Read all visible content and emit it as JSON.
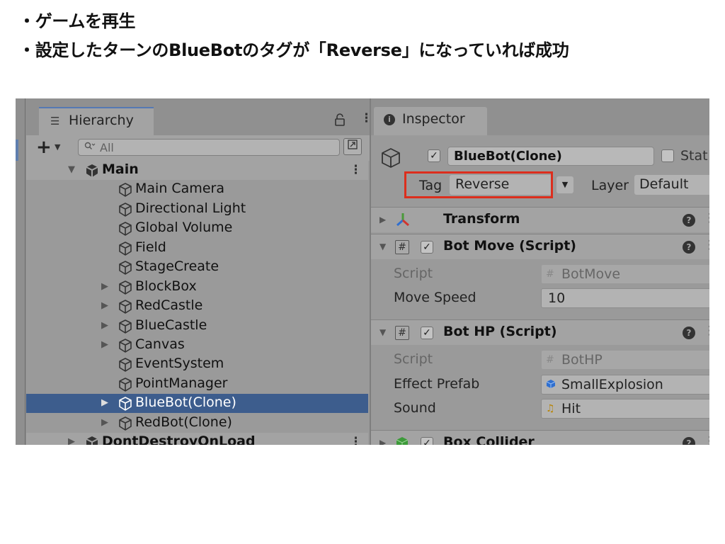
{
  "slide": {
    "bullets": [
      "・ゲームを再生",
      "・設定したターンのBlueBotのタグが「Reverse」になっていれば成功"
    ]
  },
  "hierarchy": {
    "tab_label": "Hierarchy",
    "search_placeholder": "All",
    "items": [
      {
        "label": "Main"
      },
      {
        "label": "Main Camera"
      },
      {
        "label": "Directional Light"
      },
      {
        "label": "Global Volume"
      },
      {
        "label": "Field"
      },
      {
        "label": "StageCreate"
      },
      {
        "label": "BlockBox"
      },
      {
        "label": "RedCastle"
      },
      {
        "label": "BlueCastle"
      },
      {
        "label": "Canvas"
      },
      {
        "label": "EventSystem"
      },
      {
        "label": "PointManager"
      },
      {
        "label": "BlueBot(Clone)"
      },
      {
        "label": "RedBot(Clone)"
      },
      {
        "label": "DontDestroyOnLoad"
      }
    ]
  },
  "inspector": {
    "tab_label": "Inspector",
    "object_name": "BlueBot(Clone)",
    "static_label": "Stat",
    "tag_label": "Tag",
    "tag_value": "Reverse",
    "layer_label": "Layer",
    "layer_value": "Default",
    "components": [
      {
        "title": "Transform"
      },
      {
        "title": "Bot Move (Script)"
      },
      {
        "title": "Bot HP (Script)"
      },
      {
        "title": "Box Collider"
      }
    ],
    "bot_move": {
      "script_label": "Script",
      "script_value": "BotMove",
      "speed_label": "Move Speed",
      "speed_value": "10"
    },
    "bot_hp": {
      "script_label": "Script",
      "script_value": "BotHP",
      "prefab_label": "Effect Prefab",
      "prefab_value": "SmallExplosion",
      "sound_label": "Sound",
      "sound_value": "Hit"
    }
  },
  "colors": {
    "selection": "#3d5d8d",
    "highlight_box": "#dc2e1d"
  }
}
